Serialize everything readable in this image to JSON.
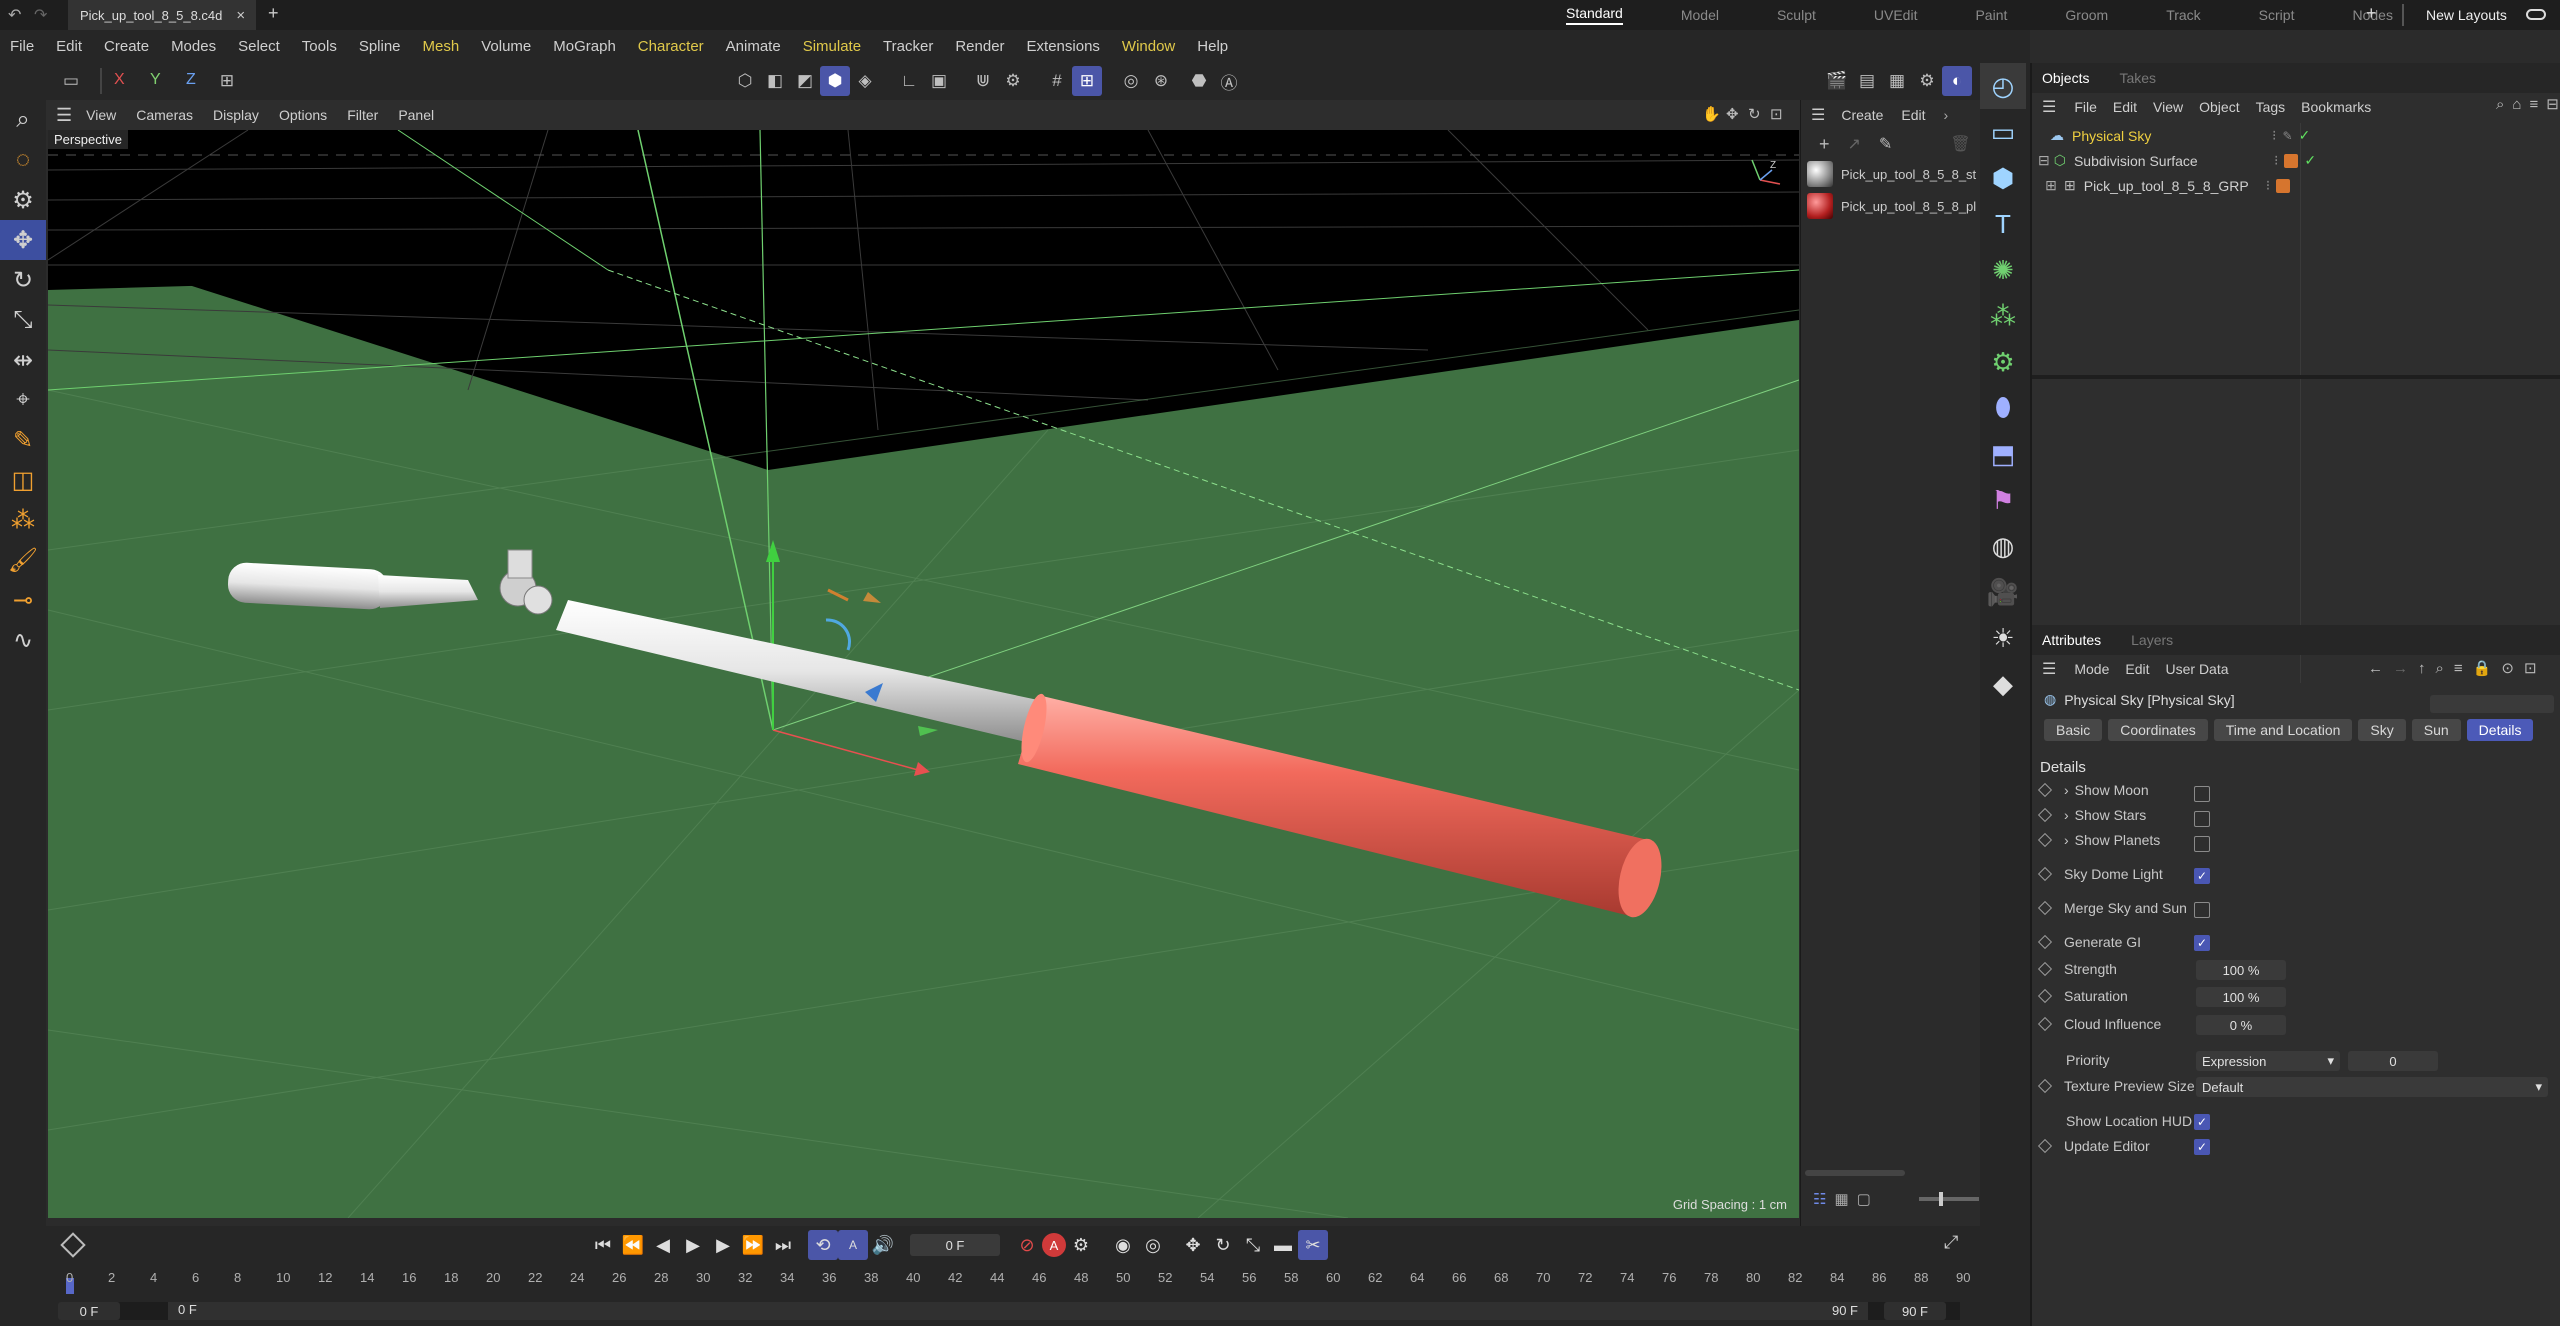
{
  "titlebar": {
    "doc_tab": "Pick_up_tool_8_5_8.c4d",
    "close": "×",
    "new_tab": "+",
    "layouts": [
      "Standard",
      "Model",
      "Sculpt",
      "UVEdit",
      "Paint",
      "Groom",
      "Track",
      "Script",
      "Nodes"
    ],
    "active_layout": "Standard",
    "add": "+",
    "new_layouts": "New Layouts"
  },
  "menu": [
    "File",
    "Edit",
    "Create",
    "Modes",
    "Select",
    "Tools",
    "Spline",
    "Mesh",
    "Volume",
    "MoGraph",
    "Character",
    "Animate",
    "Simulate",
    "Tracker",
    "Render",
    "Extensions",
    "Window",
    "Help"
  ],
  "menu_highlight": [
    "Mesh",
    "Character",
    "Simulate",
    "Window"
  ],
  "axes": {
    "x": "X",
    "y": "Y",
    "z": "Z"
  },
  "viewport": {
    "menu": [
      "View",
      "Cameras",
      "Display",
      "Options",
      "Filter",
      "Panel"
    ],
    "camera_label": "Perspective",
    "grid_spacing": "Grid Spacing : 1 cm"
  },
  "materials": {
    "menu": [
      "Create",
      "Edit"
    ],
    "items": [
      "Pick_up_tool_8_5_8_st",
      "Pick_up_tool_8_5_8_pl"
    ]
  },
  "objects": {
    "tabs": [
      "Objects",
      "Takes"
    ],
    "active_tab": "Objects",
    "menu": [
      "File",
      "Edit",
      "View",
      "Object",
      "Tags",
      "Bookmarks"
    ],
    "rows": [
      {
        "name": "Physical Sky",
        "selected": true
      },
      {
        "name": "Subdivision Surface"
      },
      {
        "name": "Pick_up_tool_8_5_8_GRP"
      }
    ]
  },
  "attributes": {
    "tabs": [
      "Attributes",
      "Layers"
    ],
    "active_tab": "Attributes",
    "menu": [
      "Mode",
      "Edit",
      "User Data"
    ],
    "object_title": "Physical Sky [Physical Sky]",
    "subtabs": [
      "Basic",
      "Coordinates",
      "Time and Location",
      "Sky",
      "Sun",
      "Details"
    ],
    "active_subtab": "Details",
    "section": "Details",
    "show_moon": "Show Moon",
    "show_stars": "Show Stars",
    "show_planets": "Show Planets",
    "sky_dome_light": "Sky Dome Light",
    "merge_sky_sun": "Merge Sky and Sun",
    "generate_gi": "Generate GI",
    "strength_label": "Strength",
    "strength_value": "100 %",
    "saturation_label": "Saturation",
    "saturation_value": "100 %",
    "cloud_label": "Cloud Influence",
    "cloud_value": "0 %",
    "priority_label": "Priority",
    "priority_value": "Expression",
    "priority_num": "0",
    "texture_label": "Texture Preview Size",
    "texture_value": "Default",
    "show_hud": "Show Location HUD",
    "update_editor": "Update Editor"
  },
  "timeline": {
    "current_frame": "0 F",
    "start": "0 F",
    "start2": "0 F",
    "end": "90 F",
    "end2": "90 F",
    "ticks": [
      "0",
      "2",
      "4",
      "6",
      "8",
      "10",
      "12",
      "14",
      "16",
      "18",
      "20",
      "22",
      "24",
      "26",
      "28",
      "30",
      "32",
      "34",
      "36",
      "38",
      "40",
      "42",
      "44",
      "46",
      "48",
      "50",
      "52",
      "54",
      "56",
      "58",
      "60",
      "62",
      "64",
      "66",
      "68",
      "70",
      "72",
      "74",
      "76",
      "78",
      "80",
      "82",
      "84",
      "86",
      "88",
      "90"
    ]
  },
  "colors": {
    "accent": "#4b56a8",
    "handle_red": "#e8574a",
    "ground": "#3f7142",
    "sky": "#000000"
  }
}
